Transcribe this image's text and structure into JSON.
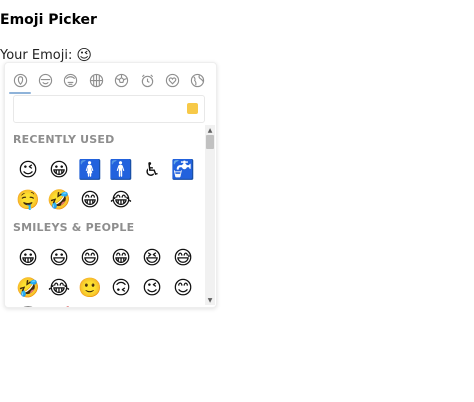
{
  "page": {
    "title": "Emoji Picker",
    "your_emoji_label": "Your Emoji:",
    "selected_emoji": "😉"
  },
  "picker": {
    "categories": [
      {
        "name": "recent",
        "icon": "clock-face-icon",
        "active": true
      },
      {
        "name": "smileys",
        "icon": "smiley-icon",
        "active": false
      },
      {
        "name": "people",
        "icon": "person-icon",
        "active": false
      },
      {
        "name": "animals",
        "icon": "globe-icon",
        "active": false
      },
      {
        "name": "activity",
        "icon": "ball-icon",
        "active": false
      },
      {
        "name": "objects",
        "icon": "alarm-clock-icon",
        "active": false
      },
      {
        "name": "symbols",
        "icon": "heart-icon",
        "active": false
      },
      {
        "name": "flags",
        "icon": "earth-icon",
        "active": false
      }
    ],
    "search": {
      "value": "",
      "placeholder": ""
    },
    "skin_tone_color": "#f7c948",
    "sections": [
      {
        "title": "RECENTLY USED",
        "emojis": [
          "😉",
          "😀",
          "🚺",
          "🚹",
          "♿",
          "🚰",
          "🤤",
          "🤣",
          "😁",
          "😂"
        ]
      },
      {
        "title": "SMILEYS & PEOPLE",
        "emojis": [
          "😀",
          "😃",
          "😄",
          "😁",
          "😆",
          "😅",
          "🤣",
          "😂",
          "🙂",
          "🙃",
          "😉",
          "😊",
          "😇",
          "🥰",
          "😍",
          "🤩",
          "😘",
          "😗"
        ]
      }
    ]
  }
}
